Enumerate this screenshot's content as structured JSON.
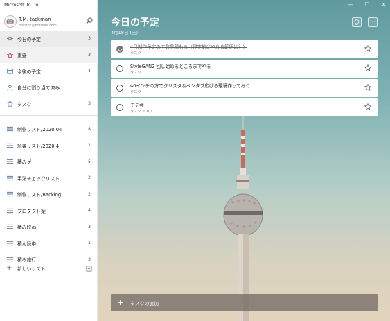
{
  "app": {
    "title": "Microsoft To Do"
  },
  "profile": {
    "name": "T.M. tackman",
    "email": "prestoc@hotmail.com",
    "avatar_glyph": "🤖"
  },
  "sidebar": {
    "smart_lists": [
      {
        "label": "今日の予定",
        "count": "3",
        "icon": "sun-icon",
        "active": true
      },
      {
        "label": "重要",
        "count": "3",
        "icon": "star-icon"
      },
      {
        "label": "今後の予定",
        "count": "4",
        "icon": "calendar-icon"
      },
      {
        "label": "自分に割り当て済み",
        "count": "",
        "icon": "person-icon"
      },
      {
        "label": "タスク",
        "count": "3",
        "icon": "home-icon"
      }
    ],
    "lists": [
      {
        "label": "制作リスト/2020.04",
        "count": "8"
      },
      {
        "label": "読書リスト/2020.4",
        "count": "1"
      },
      {
        "label": "積みゲー",
        "count": "5"
      },
      {
        "label": "手法チェックリスト",
        "count": "2"
      },
      {
        "label": "制作リスト/Backlog",
        "count": "2"
      },
      {
        "label": "プロダクト案",
        "count": "4"
      },
      {
        "label": "積み映画",
        "count": "3"
      },
      {
        "label": "積ん読中",
        "count": "1"
      },
      {
        "label": "積み旅行",
        "count": "3"
      }
    ],
    "new_list_label": "新しいリスト"
  },
  "main": {
    "title": "今日の予定",
    "date": "4月18日 (土)",
    "tasks": [
      {
        "name": "4月制作予定の工数見積もる（現実的にやれる範囲は？）",
        "sub": "タスク",
        "done": true
      },
      {
        "name": "StyleGAN2 回し始めるところまでやる",
        "sub": "タスク",
        "done": false
      },
      {
        "name": "40インチの方でクリスタ＆ペンタブ広げる環境作っておく",
        "sub": "タスク",
        "done": false
      },
      {
        "name": "モデ会",
        "sub": "タスク ・ 0/1",
        "done": false
      }
    ],
    "add_task_label": "タスクの追加"
  },
  "colors": {
    "accent_star": "#c23b5c",
    "background_sky": "#6ea6a9"
  }
}
